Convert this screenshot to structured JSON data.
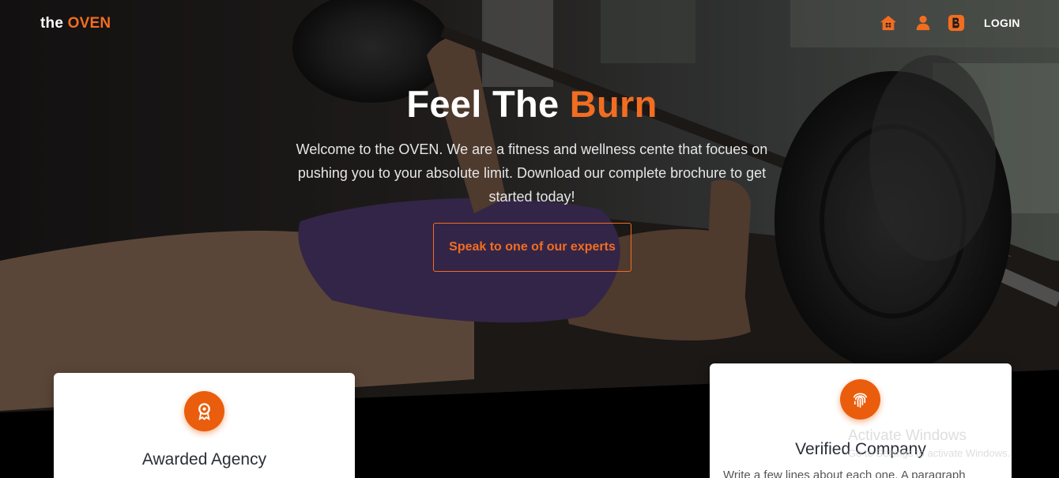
{
  "navbar": {
    "brand_prefix": "the",
    "brand_accent": "OVEN",
    "login_label": "LOGIN",
    "icons": [
      "home-icon",
      "user-icon",
      "blogger-icon"
    ]
  },
  "hero": {
    "headline_main": "Feel The",
    "headline_accent": "Burn",
    "intro": "Welcome to the OVEN. We are a fitness and wellness cente that focues on pushing you to your absolute limit. Download our complete brochure to get started today!",
    "cta_label": "Speak to one of our experts"
  },
  "cards": [
    {
      "icon": "award-icon",
      "title": "Awarded Agency",
      "text": ""
    },
    {
      "icon": "fingerprint-icon",
      "title": "Verified Company",
      "text": "Write a few lines about each one. A paragraph"
    }
  ],
  "watermark": {
    "title": "Activate Windows",
    "subtitle": "Go to Settings to activate Windows."
  },
  "colors": {
    "accent": "#f26d21",
    "icon_circle": "#ea5d0c",
    "card_bg": "#ffffff",
    "page_bg": "#000000"
  }
}
